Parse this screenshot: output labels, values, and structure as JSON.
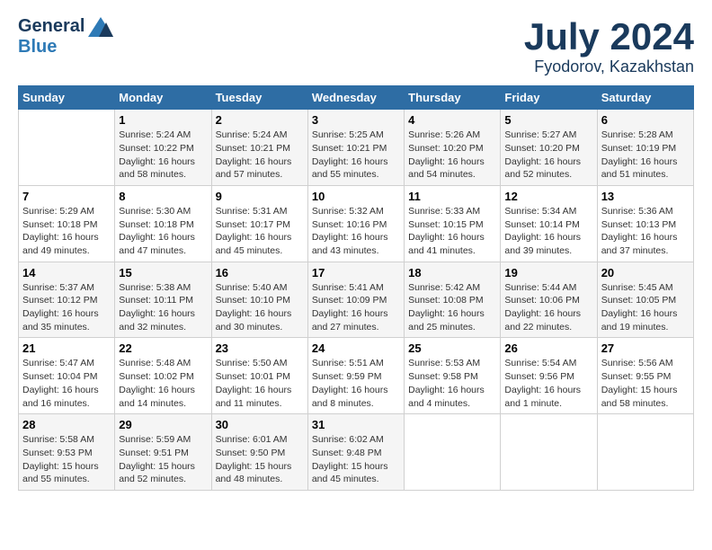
{
  "header": {
    "logo_general": "General",
    "logo_blue": "Blue",
    "month_year": "July 2024",
    "location": "Fyodorov, Kazakhstan"
  },
  "days_of_week": [
    "Sunday",
    "Monday",
    "Tuesday",
    "Wednesday",
    "Thursday",
    "Friday",
    "Saturday"
  ],
  "weeks": [
    [
      {
        "num": "",
        "info": ""
      },
      {
        "num": "1",
        "info": "Sunrise: 5:24 AM\nSunset: 10:22 PM\nDaylight: 16 hours\nand 58 minutes."
      },
      {
        "num": "2",
        "info": "Sunrise: 5:24 AM\nSunset: 10:21 PM\nDaylight: 16 hours\nand 57 minutes."
      },
      {
        "num": "3",
        "info": "Sunrise: 5:25 AM\nSunset: 10:21 PM\nDaylight: 16 hours\nand 55 minutes."
      },
      {
        "num": "4",
        "info": "Sunrise: 5:26 AM\nSunset: 10:20 PM\nDaylight: 16 hours\nand 54 minutes."
      },
      {
        "num": "5",
        "info": "Sunrise: 5:27 AM\nSunset: 10:20 PM\nDaylight: 16 hours\nand 52 minutes."
      },
      {
        "num": "6",
        "info": "Sunrise: 5:28 AM\nSunset: 10:19 PM\nDaylight: 16 hours\nand 51 minutes."
      }
    ],
    [
      {
        "num": "7",
        "info": "Sunrise: 5:29 AM\nSunset: 10:18 PM\nDaylight: 16 hours\nand 49 minutes."
      },
      {
        "num": "8",
        "info": "Sunrise: 5:30 AM\nSunset: 10:18 PM\nDaylight: 16 hours\nand 47 minutes."
      },
      {
        "num": "9",
        "info": "Sunrise: 5:31 AM\nSunset: 10:17 PM\nDaylight: 16 hours\nand 45 minutes."
      },
      {
        "num": "10",
        "info": "Sunrise: 5:32 AM\nSunset: 10:16 PM\nDaylight: 16 hours\nand 43 minutes."
      },
      {
        "num": "11",
        "info": "Sunrise: 5:33 AM\nSunset: 10:15 PM\nDaylight: 16 hours\nand 41 minutes."
      },
      {
        "num": "12",
        "info": "Sunrise: 5:34 AM\nSunset: 10:14 PM\nDaylight: 16 hours\nand 39 minutes."
      },
      {
        "num": "13",
        "info": "Sunrise: 5:36 AM\nSunset: 10:13 PM\nDaylight: 16 hours\nand 37 minutes."
      }
    ],
    [
      {
        "num": "14",
        "info": "Sunrise: 5:37 AM\nSunset: 10:12 PM\nDaylight: 16 hours\nand 35 minutes."
      },
      {
        "num": "15",
        "info": "Sunrise: 5:38 AM\nSunset: 10:11 PM\nDaylight: 16 hours\nand 32 minutes."
      },
      {
        "num": "16",
        "info": "Sunrise: 5:40 AM\nSunset: 10:10 PM\nDaylight: 16 hours\nand 30 minutes."
      },
      {
        "num": "17",
        "info": "Sunrise: 5:41 AM\nSunset: 10:09 PM\nDaylight: 16 hours\nand 27 minutes."
      },
      {
        "num": "18",
        "info": "Sunrise: 5:42 AM\nSunset: 10:08 PM\nDaylight: 16 hours\nand 25 minutes."
      },
      {
        "num": "19",
        "info": "Sunrise: 5:44 AM\nSunset: 10:06 PM\nDaylight: 16 hours\nand 22 minutes."
      },
      {
        "num": "20",
        "info": "Sunrise: 5:45 AM\nSunset: 10:05 PM\nDaylight: 16 hours\nand 19 minutes."
      }
    ],
    [
      {
        "num": "21",
        "info": "Sunrise: 5:47 AM\nSunset: 10:04 PM\nDaylight: 16 hours\nand 16 minutes."
      },
      {
        "num": "22",
        "info": "Sunrise: 5:48 AM\nSunset: 10:02 PM\nDaylight: 16 hours\nand 14 minutes."
      },
      {
        "num": "23",
        "info": "Sunrise: 5:50 AM\nSunset: 10:01 PM\nDaylight: 16 hours\nand 11 minutes."
      },
      {
        "num": "24",
        "info": "Sunrise: 5:51 AM\nSunset: 9:59 PM\nDaylight: 16 hours\nand 8 minutes."
      },
      {
        "num": "25",
        "info": "Sunrise: 5:53 AM\nSunset: 9:58 PM\nDaylight: 16 hours\nand 4 minutes."
      },
      {
        "num": "26",
        "info": "Sunrise: 5:54 AM\nSunset: 9:56 PM\nDaylight: 16 hours\nand 1 minute."
      },
      {
        "num": "27",
        "info": "Sunrise: 5:56 AM\nSunset: 9:55 PM\nDaylight: 15 hours\nand 58 minutes."
      }
    ],
    [
      {
        "num": "28",
        "info": "Sunrise: 5:58 AM\nSunset: 9:53 PM\nDaylight: 15 hours\nand 55 minutes."
      },
      {
        "num": "29",
        "info": "Sunrise: 5:59 AM\nSunset: 9:51 PM\nDaylight: 15 hours\nand 52 minutes."
      },
      {
        "num": "30",
        "info": "Sunrise: 6:01 AM\nSunset: 9:50 PM\nDaylight: 15 hours\nand 48 minutes."
      },
      {
        "num": "31",
        "info": "Sunrise: 6:02 AM\nSunset: 9:48 PM\nDaylight: 15 hours\nand 45 minutes."
      },
      {
        "num": "",
        "info": ""
      },
      {
        "num": "",
        "info": ""
      },
      {
        "num": "",
        "info": ""
      }
    ]
  ]
}
